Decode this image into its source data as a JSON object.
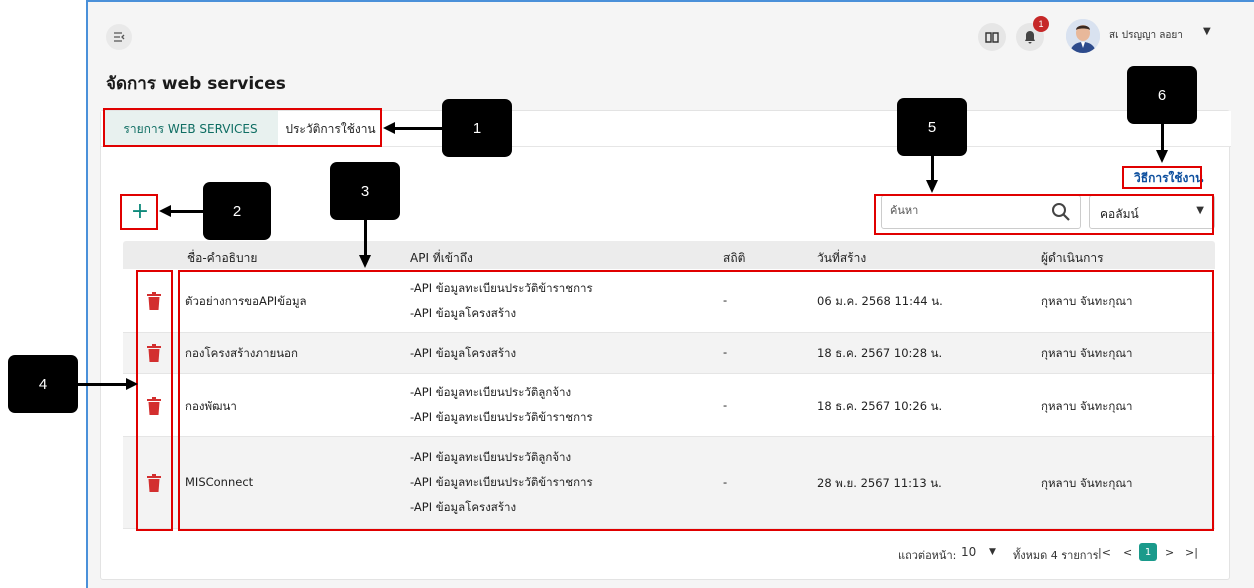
{
  "header": {
    "user_name": "ปรญญา ลอยา",
    "user_prefix": "สเ",
    "notification_count": "1"
  },
  "page": {
    "title": "จัดการ web services"
  },
  "tabs": [
    {
      "label": "รายการ WEB SERVICES",
      "active": true
    },
    {
      "label": "ประวัติการใช้งาน",
      "active": false
    }
  ],
  "toolbar": {
    "howto_label": "วิธีการใช้งาน",
    "add_label": "+",
    "search_placeholder": "ค้นหา",
    "column_select": "คอลัมน์"
  },
  "table": {
    "columns": [
      "ชื่อ-คำอธิบาย",
      "API ที่เข้าถึง",
      "สถิติ",
      "วันที่สร้าง",
      "ผู้ดำเนินการ"
    ],
    "rows": [
      {
        "name": "ตัวอย่างการขอAPIข้อมูล",
        "apis": [
          "-API ข้อมูลทะเบียนประวัติข้าราชการ",
          "-API ข้อมูลโครงสร้าง"
        ],
        "stats": "-",
        "created": "06 ม.ค. 2568 11:44 น.",
        "operator": "กุหลาบ จันทะกุณา"
      },
      {
        "name": "กองโครงสร้างภายนอก",
        "apis": [
          "-API ข้อมูลโครงสร้าง"
        ],
        "stats": "-",
        "created": "18 ธ.ค. 2567 10:28 น.",
        "operator": "กุหลาบ จันทะกุณา"
      },
      {
        "name": "กองพัฒนา",
        "apis": [
          "-API ข้อมูลทะเบียนประวัติลูกจ้าง",
          "-API ข้อมูลทะเบียนประวัติข้าราชการ"
        ],
        "stats": "-",
        "created": "18 ธ.ค. 2567 10:26 น.",
        "operator": "กุหลาบ จันทะกุณา"
      },
      {
        "name": "MISConnect",
        "apis": [
          "-API ข้อมูลทะเบียนประวัติลูกจ้าง",
          "-API ข้อมูลทะเบียนประวัติข้าราชการ",
          "-API ข้อมูลโครงสร้าง"
        ],
        "stats": "-",
        "created": "28 พ.ย. 2567 11:13 น.",
        "operator": "กุหลาบ จันทะกุณา"
      }
    ]
  },
  "pagination": {
    "rows_per_page_label": "แถวต่อหน้า:",
    "rows_per_page": "10",
    "total_label": "ทั้งหมด 4 รายการ",
    "current_page": "1"
  },
  "callouts": [
    "1",
    "2",
    "3",
    "4",
    "5",
    "6"
  ],
  "colors": {
    "accent": "#0f8a7b",
    "delete": "#d32f2f",
    "annotation": "#e00000",
    "link": "#0d4f9e"
  }
}
